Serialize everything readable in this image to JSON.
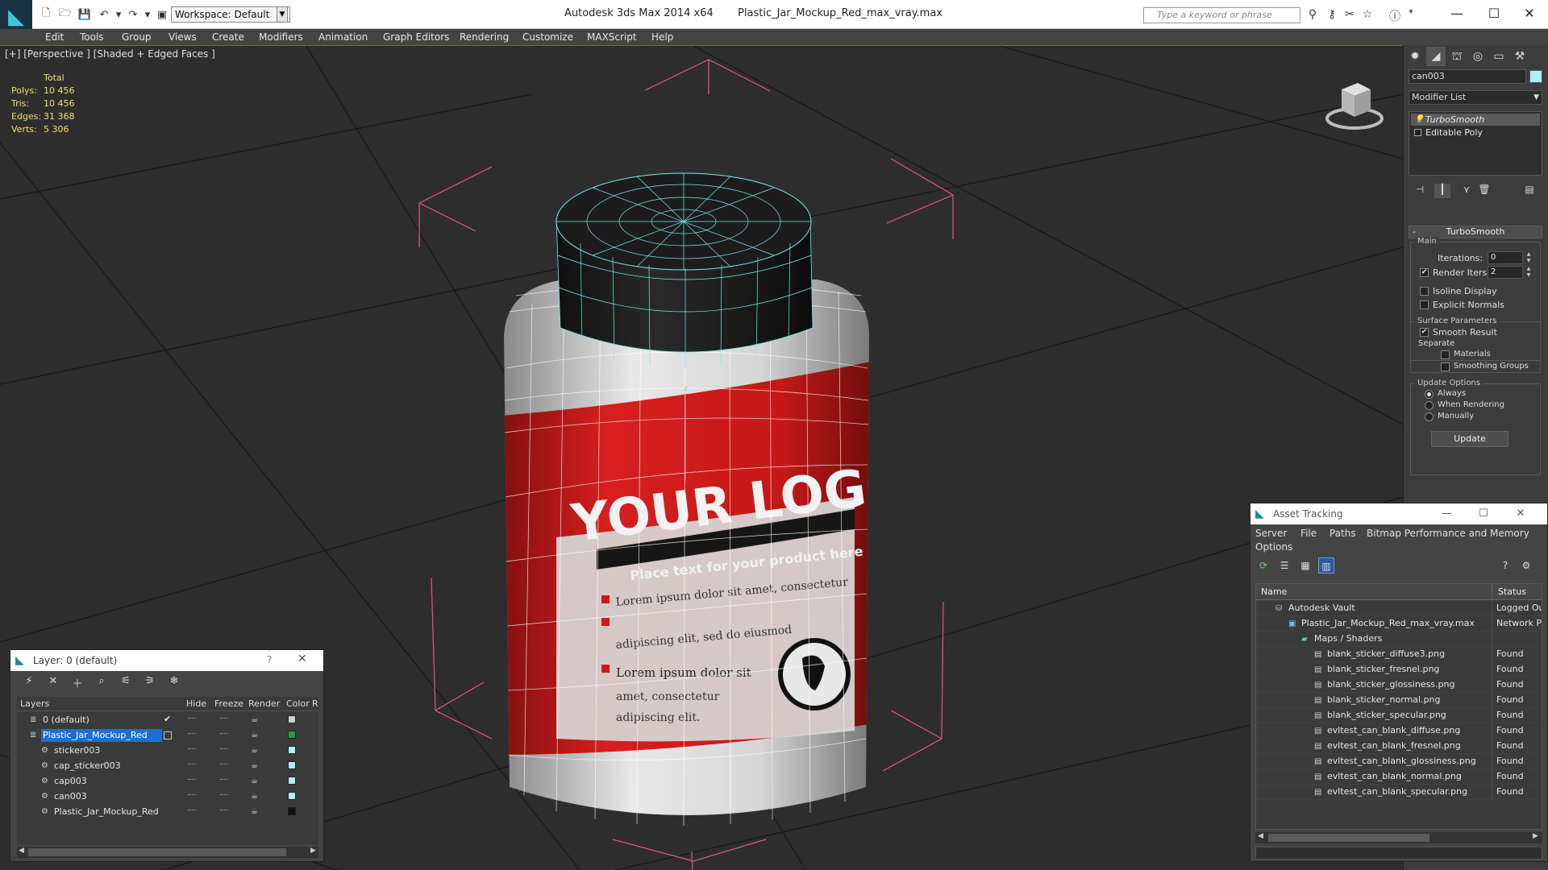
{
  "titlebar": {
    "workspace": "Workspace: Default",
    "app_title": "Autodesk 3ds Max  2014 x64",
    "file_title": "Plastic_Jar_Mockup_Red_max_vray.max",
    "search_placeholder": "Type a keyword or phrase"
  },
  "menu": [
    "Edit",
    "Tools",
    "Group",
    "Views",
    "Create",
    "Modifiers",
    "Animation",
    "Graph Editors",
    "Rendering",
    "Customize",
    "MAXScript",
    "Help"
  ],
  "viewport": {
    "label": "[+] [Perspective ] [Shaded + Edged Faces ]",
    "stats_header": "Total",
    "stats": [
      {
        "label": "Polys:",
        "value": "10 456"
      },
      {
        "label": "Tris:",
        "value": "10 456"
      },
      {
        "label": "Edges:",
        "value": "31 368"
      },
      {
        "label": "Verts:",
        "value": "5 306"
      }
    ],
    "jar_label_title": "YOUR LOGO",
    "jar_label_tagline": "Place text for your product here",
    "jar_label_lines": [
      "Lorem ipsum dolor sit amet, consectetur",
      "adipiscing elit, sed do eiusmod",
      "Lorem ipsum dolor sit",
      "amet, consectetur",
      "adipiscing elit."
    ]
  },
  "command_panel": {
    "object_name": "can003",
    "object_color": "#a7f4f4",
    "modifier_list": "Modifier List",
    "stack": [
      "TurboSmooth",
      "Editable Poly"
    ],
    "rollout_title": "TurboSmooth",
    "main_group": "Main",
    "iterations_label": "Iterations:",
    "iterations_value": "0",
    "render_iters_label": "Render Iters:",
    "render_iters_value": "2",
    "render_iters_checked": true,
    "isoline_label": "Isoline Display",
    "explicit_normals_label": "Explicit Normals",
    "surface_group": "Surface Parameters",
    "smooth_result_label": "Smooth Result",
    "separate_label": "Separate",
    "materials_label": "Materials",
    "smoothing_groups_label": "Smoothing Groups",
    "update_group": "Update Options",
    "update_always": "Always",
    "update_when_rendering": "When Rendering",
    "update_manually": "Manually",
    "update_button": "Update"
  },
  "layer_dialog": {
    "title": "Layer: 0 (default)",
    "help": "?",
    "columns": [
      "Layers",
      "Hide",
      "Freeze",
      "Render",
      "Color",
      "R"
    ],
    "rows": [
      {
        "name": "0 (default)",
        "indent": 0,
        "color": "#cfcfcf",
        "current": true,
        "selected": false
      },
      {
        "name": "Plastic_Jar_Mockup_Red",
        "indent": 0,
        "color": "#1f9a4c",
        "current": false,
        "selected": true
      },
      {
        "name": "sticker003",
        "indent": 1,
        "color": "#a7f4f4",
        "current": false,
        "selected": false
      },
      {
        "name": "cap_sticker003",
        "indent": 1,
        "color": "#a7f4f4",
        "current": false,
        "selected": false
      },
      {
        "name": "cap003",
        "indent": 1,
        "color": "#a7f4f4",
        "current": false,
        "selected": false
      },
      {
        "name": "can003",
        "indent": 1,
        "color": "#a7f4f4",
        "current": false,
        "selected": false
      },
      {
        "name": "Plastic_Jar_Mockup_Red",
        "indent": 1,
        "color": "#111111",
        "current": false,
        "selected": false
      }
    ]
  },
  "asset_dialog": {
    "title": "Asset Tracking",
    "menu": [
      "Server",
      "File",
      "Paths",
      "Bitmap Performance and Memory",
      "Options"
    ],
    "columns": [
      "Name",
      "Status"
    ],
    "rows": [
      {
        "name": "Autodesk Vault",
        "indent": 0,
        "status": "Logged Out",
        "icon": "vault-icon"
      },
      {
        "name": "Plastic_Jar_Mockup_Red_max_vray.max",
        "indent": 1,
        "status": "Network Path",
        "icon": "max-file-icon"
      },
      {
        "name": "Maps / Shaders",
        "indent": 2,
        "status": "",
        "icon": "maps-icon"
      },
      {
        "name": "blank_sticker_diffuse3.png",
        "indent": 3,
        "status": "Found",
        "icon": "image-file-icon"
      },
      {
        "name": "blank_sticker_fresnel.png",
        "indent": 3,
        "status": "Found",
        "icon": "image-file-icon"
      },
      {
        "name": "blank_sticker_glossiness.png",
        "indent": 3,
        "status": "Found",
        "icon": "image-file-icon"
      },
      {
        "name": "blank_sticker_normal.png",
        "indent": 3,
        "status": "Found",
        "icon": "image-file-icon"
      },
      {
        "name": "blank_sticker_specular.png",
        "indent": 3,
        "status": "Found",
        "icon": "image-file-icon"
      },
      {
        "name": "evltest_can_blank_diffuse.png",
        "indent": 3,
        "status": "Found",
        "icon": "image-file-icon"
      },
      {
        "name": "evltest_can_blank_fresnel.png",
        "indent": 3,
        "status": "Found",
        "icon": "image-file-icon"
      },
      {
        "name": "evltest_can_blank_glossiness.png",
        "indent": 3,
        "status": "Found",
        "icon": "image-file-icon"
      },
      {
        "name": "evltest_can_blank_normal.png",
        "indent": 3,
        "status": "Found",
        "icon": "image-file-icon"
      },
      {
        "name": "evltest_can_blank_specular.png",
        "indent": 3,
        "status": "Found",
        "icon": "image-file-icon"
      }
    ]
  }
}
